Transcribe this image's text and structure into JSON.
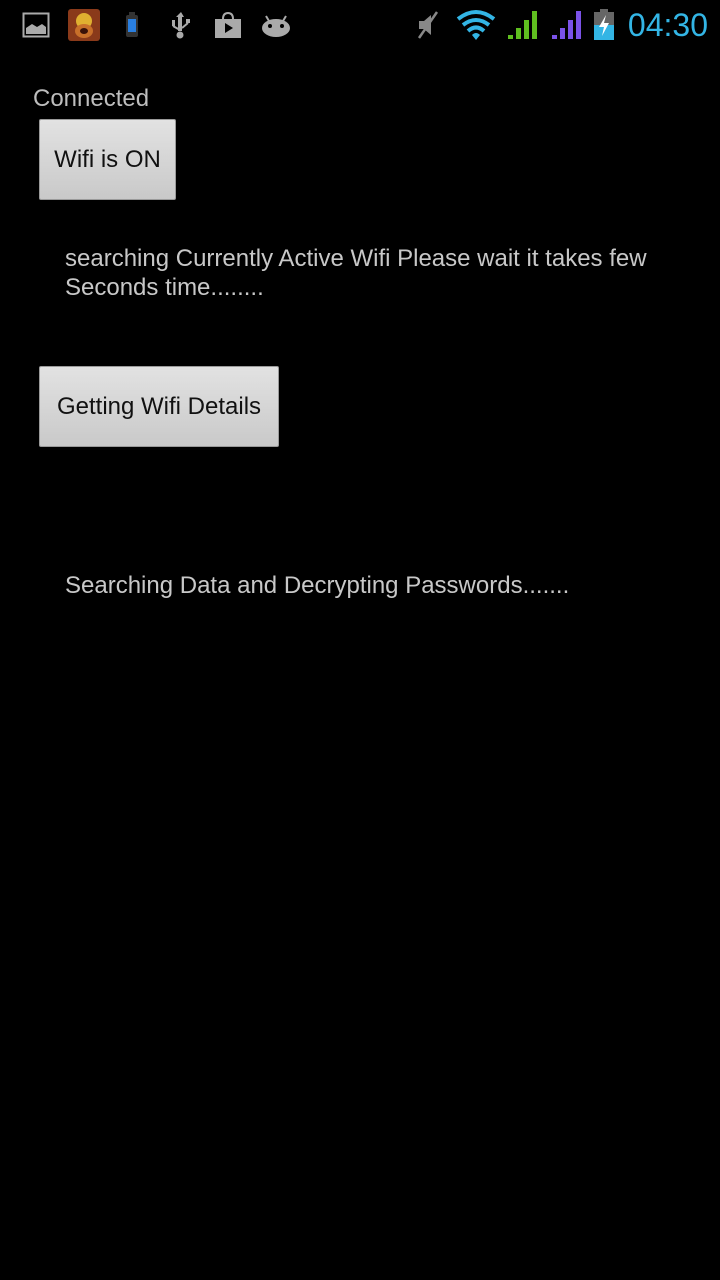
{
  "status_bar": {
    "left_icons": [
      "gallery-icon",
      "clash-of-clans-app-icon",
      "battery-widget-icon",
      "usb-icon",
      "play-store-icon",
      "android-debug-icon"
    ],
    "right_icons": [
      "mute-icon",
      "wifi-signal-icon",
      "cell-signal-green-icon",
      "cell-signal-purple-icon",
      "battery-charging-icon"
    ],
    "time": "04:30",
    "colors": {
      "time": "#33b5e5",
      "wifi": "#33b5e5",
      "signal1": "#5fbf1f",
      "signal2": "#7b52e8",
      "battery": "#33b5e5"
    }
  },
  "main": {
    "connection_status": "Connected",
    "wifi_button_label": "Wifi is ON",
    "search_message": "searching Currently Active Wifi Please wait it takes few Seconds time........",
    "details_button_label": "Getting Wifi Details",
    "decrypt_message": "Searching Data and Decrypting Passwords......."
  }
}
